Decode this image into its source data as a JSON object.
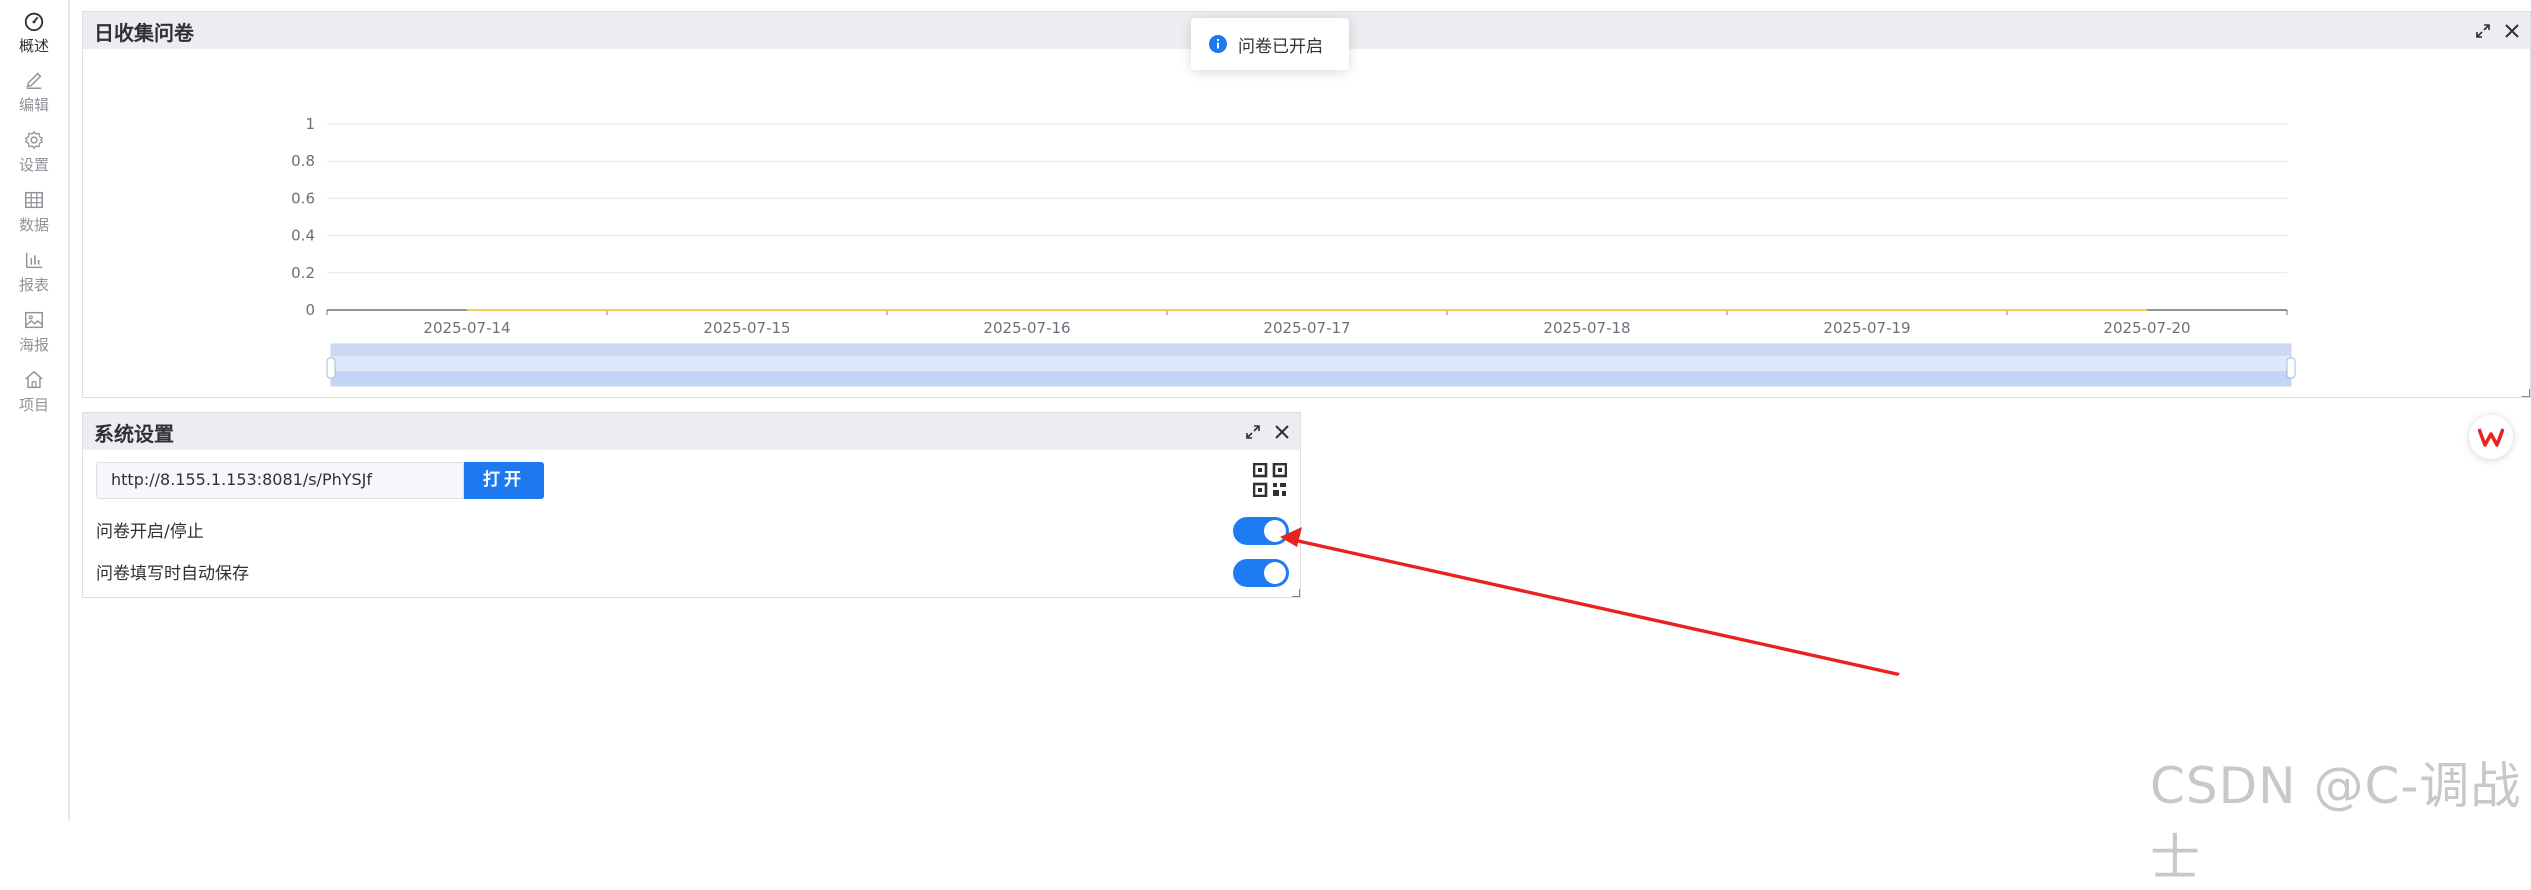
{
  "sidebar": {
    "items": [
      {
        "label": "概述",
        "icon": "dashboard-icon"
      },
      {
        "label": "编辑",
        "icon": "pencil-icon"
      },
      {
        "label": "设置",
        "icon": "gear-icon"
      },
      {
        "label": "数据",
        "icon": "table-grid-icon"
      },
      {
        "label": "报表",
        "icon": "bar-chart-icon"
      },
      {
        "label": "海报",
        "icon": "image-icon"
      },
      {
        "label": "项目",
        "icon": "home-icon"
      }
    ],
    "active_index": 0
  },
  "daily_panel": {
    "title": "日收集问卷"
  },
  "toast": {
    "message": "问卷已开启",
    "icon": "info-icon"
  },
  "chart_data": {
    "type": "line",
    "title": "日收集问卷",
    "categories": [
      "2025-07-14",
      "2025-07-15",
      "2025-07-16",
      "2025-07-17",
      "2025-07-18",
      "2025-07-19",
      "2025-07-20"
    ],
    "series": [
      {
        "values": [
          0,
          0,
          0,
          0,
          0,
          0,
          0
        ],
        "color": "#fac858"
      }
    ],
    "y_ticks": [
      "0",
      "0.2",
      "0.4",
      "0.6",
      "0.8",
      "1"
    ],
    "ylim": [
      0,
      1
    ],
    "xlabel": "",
    "ylabel": "",
    "grid": true,
    "data_zoom": {
      "start_percent": 0,
      "end_percent": 100
    }
  },
  "settings_panel": {
    "title": "系统设置",
    "url": "http://8.155.1.153:8081/s/PhYSJf",
    "open_label": "打开",
    "qr_icon": "qrcode-icon",
    "settings": [
      {
        "label": "问卷开启/停止",
        "enabled": true
      },
      {
        "label": "问卷填写时自动保存",
        "enabled": true
      }
    ]
  },
  "watermark": "CSDN @C-调战士",
  "colors": {
    "primary": "#1e78f0",
    "annotation_arrow": "#e8231f",
    "panel_header": "#ebedf1"
  }
}
